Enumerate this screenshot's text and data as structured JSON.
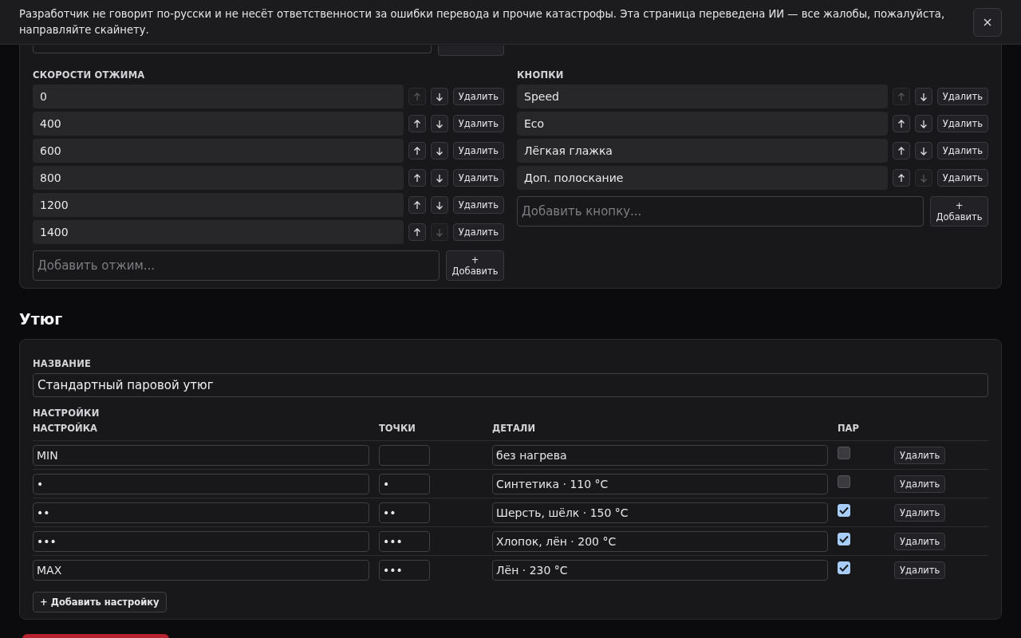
{
  "banner": {
    "text": "Разработчик не говорит по-русски и не несёт ответственности за ошибки перевода и прочие катастрофы. Эта страница переведена ИИ — все жалобы, пожалуйста, направляйте скайнету."
  },
  "washer": {
    "lists": [
      {
        "label": "СКОРОСТИ ОТЖИМА",
        "items": [
          {
            "value": "0",
            "up_disabled": true,
            "down_disabled": false,
            "delete": "Удалить"
          },
          {
            "value": "400",
            "up_disabled": false,
            "down_disabled": false,
            "delete": "Удалить"
          },
          {
            "value": "600",
            "up_disabled": false,
            "down_disabled": false,
            "delete": "Удалить"
          },
          {
            "value": "800",
            "up_disabled": false,
            "down_disabled": false,
            "delete": "Удалить"
          },
          {
            "value": "1200",
            "up_disabled": false,
            "down_disabled": false,
            "delete": "Удалить"
          },
          {
            "value": "1400",
            "up_disabled": false,
            "down_disabled": true,
            "delete": "Удалить"
          }
        ],
        "add": {
          "placeholder": "Добавить отжим...",
          "button": "+ Добавить"
        }
      },
      {
        "label": "КНОПКИ",
        "items": [
          {
            "value": "Speed",
            "up_disabled": true,
            "down_disabled": false,
            "delete": "Удалить"
          },
          {
            "value": "Eco",
            "up_disabled": false,
            "down_disabled": false,
            "delete": "Удалить"
          },
          {
            "value": "Лёгкая глажка",
            "up_disabled": false,
            "down_disabled": false,
            "delete": "Удалить"
          },
          {
            "value": "Доп. полоскание",
            "up_disabled": false,
            "down_disabled": true,
            "delete": "Удалить"
          }
        ],
        "add": {
          "placeholder": "Добавить кнопку...",
          "button": "+ Добавить"
        }
      }
    ]
  },
  "iron": {
    "heading": "Утюг",
    "name_label": "НАЗВАНИЕ",
    "name_value": "Стандартный паровой утюг",
    "settings_label": "НАСТРОЙКИ",
    "columns": [
      "НАСТРОЙКА",
      "ТОЧКИ",
      "ДЕТАЛИ",
      "ПАР"
    ],
    "rows": [
      {
        "setting": "MIN",
        "details": "без нагрева",
        "steam": false,
        "delete": "Удалить"
      },
      {
        "setting": "•",
        "dots": "•",
        "details": "Синтетика · 110 °C",
        "steam": false,
        "delete": "Удалить"
      },
      {
        "setting": "••",
        "dots": "••",
        "details": "Шерсть, шёлк · 150 °C",
        "steam": true,
        "delete": "Удалить"
      },
      {
        "setting": "•••",
        "dots": "•••",
        "details": "Хлопок, лён · 200 °C",
        "steam": true,
        "delete": "Удалить"
      },
      {
        "setting": "MAX",
        "dots": "•••",
        "details": "Лён · 230 °C",
        "steam": true,
        "delete": "Удалить"
      }
    ],
    "add_button": "+ Добавить настройку"
  }
}
